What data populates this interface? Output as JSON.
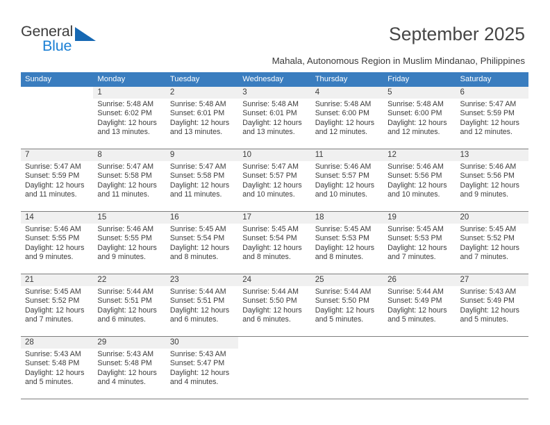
{
  "brand": {
    "word_one": "General",
    "word_two": "Blue",
    "accent_color": "#1a7fd4",
    "triangle_color": "#1668b3"
  },
  "header": {
    "title": "September 2025",
    "subtitle": "Mahala, Autonomous Region in Muslim Mindanao, Philippines"
  },
  "calendar": {
    "header_bg": "#3a7dbf",
    "daynum_band_bg": "#f0f0f0",
    "day_names": [
      "Sunday",
      "Monday",
      "Tuesday",
      "Wednesday",
      "Thursday",
      "Friday",
      "Saturday"
    ],
    "weeks": [
      [
        {
          "day": "",
          "lines": []
        },
        {
          "day": "1",
          "lines": [
            "Sunrise: 5:48 AM",
            "Sunset: 6:02 PM",
            "Daylight: 12 hours",
            "and 13 minutes."
          ]
        },
        {
          "day": "2",
          "lines": [
            "Sunrise: 5:48 AM",
            "Sunset: 6:01 PM",
            "Daylight: 12 hours",
            "and 13 minutes."
          ]
        },
        {
          "day": "3",
          "lines": [
            "Sunrise: 5:48 AM",
            "Sunset: 6:01 PM",
            "Daylight: 12 hours",
            "and 13 minutes."
          ]
        },
        {
          "day": "4",
          "lines": [
            "Sunrise: 5:48 AM",
            "Sunset: 6:00 PM",
            "Daylight: 12 hours",
            "and 12 minutes."
          ]
        },
        {
          "day": "5",
          "lines": [
            "Sunrise: 5:48 AM",
            "Sunset: 6:00 PM",
            "Daylight: 12 hours",
            "and 12 minutes."
          ]
        },
        {
          "day": "6",
          "lines": [
            "Sunrise: 5:47 AM",
            "Sunset: 5:59 PM",
            "Daylight: 12 hours",
            "and 12 minutes."
          ]
        }
      ],
      [
        {
          "day": "7",
          "lines": [
            "Sunrise: 5:47 AM",
            "Sunset: 5:59 PM",
            "Daylight: 12 hours",
            "and 11 minutes."
          ]
        },
        {
          "day": "8",
          "lines": [
            "Sunrise: 5:47 AM",
            "Sunset: 5:58 PM",
            "Daylight: 12 hours",
            "and 11 minutes."
          ]
        },
        {
          "day": "9",
          "lines": [
            "Sunrise: 5:47 AM",
            "Sunset: 5:58 PM",
            "Daylight: 12 hours",
            "and 11 minutes."
          ]
        },
        {
          "day": "10",
          "lines": [
            "Sunrise: 5:47 AM",
            "Sunset: 5:57 PM",
            "Daylight: 12 hours",
            "and 10 minutes."
          ]
        },
        {
          "day": "11",
          "lines": [
            "Sunrise: 5:46 AM",
            "Sunset: 5:57 PM",
            "Daylight: 12 hours",
            "and 10 minutes."
          ]
        },
        {
          "day": "12",
          "lines": [
            "Sunrise: 5:46 AM",
            "Sunset: 5:56 PM",
            "Daylight: 12 hours",
            "and 10 minutes."
          ]
        },
        {
          "day": "13",
          "lines": [
            "Sunrise: 5:46 AM",
            "Sunset: 5:56 PM",
            "Daylight: 12 hours",
            "and 9 minutes."
          ]
        }
      ],
      [
        {
          "day": "14",
          "lines": [
            "Sunrise: 5:46 AM",
            "Sunset: 5:55 PM",
            "Daylight: 12 hours",
            "and 9 minutes."
          ]
        },
        {
          "day": "15",
          "lines": [
            "Sunrise: 5:46 AM",
            "Sunset: 5:55 PM",
            "Daylight: 12 hours",
            "and 9 minutes."
          ]
        },
        {
          "day": "16",
          "lines": [
            "Sunrise: 5:45 AM",
            "Sunset: 5:54 PM",
            "Daylight: 12 hours",
            "and 8 minutes."
          ]
        },
        {
          "day": "17",
          "lines": [
            "Sunrise: 5:45 AM",
            "Sunset: 5:54 PM",
            "Daylight: 12 hours",
            "and 8 minutes."
          ]
        },
        {
          "day": "18",
          "lines": [
            "Sunrise: 5:45 AM",
            "Sunset: 5:53 PM",
            "Daylight: 12 hours",
            "and 8 minutes."
          ]
        },
        {
          "day": "19",
          "lines": [
            "Sunrise: 5:45 AM",
            "Sunset: 5:53 PM",
            "Daylight: 12 hours",
            "and 7 minutes."
          ]
        },
        {
          "day": "20",
          "lines": [
            "Sunrise: 5:45 AM",
            "Sunset: 5:52 PM",
            "Daylight: 12 hours",
            "and 7 minutes."
          ]
        }
      ],
      [
        {
          "day": "21",
          "lines": [
            "Sunrise: 5:45 AM",
            "Sunset: 5:52 PM",
            "Daylight: 12 hours",
            "and 7 minutes."
          ]
        },
        {
          "day": "22",
          "lines": [
            "Sunrise: 5:44 AM",
            "Sunset: 5:51 PM",
            "Daylight: 12 hours",
            "and 6 minutes."
          ]
        },
        {
          "day": "23",
          "lines": [
            "Sunrise: 5:44 AM",
            "Sunset: 5:51 PM",
            "Daylight: 12 hours",
            "and 6 minutes."
          ]
        },
        {
          "day": "24",
          "lines": [
            "Sunrise: 5:44 AM",
            "Sunset: 5:50 PM",
            "Daylight: 12 hours",
            "and 6 minutes."
          ]
        },
        {
          "day": "25",
          "lines": [
            "Sunrise: 5:44 AM",
            "Sunset: 5:50 PM",
            "Daylight: 12 hours",
            "and 5 minutes."
          ]
        },
        {
          "day": "26",
          "lines": [
            "Sunrise: 5:44 AM",
            "Sunset: 5:49 PM",
            "Daylight: 12 hours",
            "and 5 minutes."
          ]
        },
        {
          "day": "27",
          "lines": [
            "Sunrise: 5:43 AM",
            "Sunset: 5:49 PM",
            "Daylight: 12 hours",
            "and 5 minutes."
          ]
        }
      ],
      [
        {
          "day": "28",
          "lines": [
            "Sunrise: 5:43 AM",
            "Sunset: 5:48 PM",
            "Daylight: 12 hours",
            "and 5 minutes."
          ]
        },
        {
          "day": "29",
          "lines": [
            "Sunrise: 5:43 AM",
            "Sunset: 5:48 PM",
            "Daylight: 12 hours",
            "and 4 minutes."
          ]
        },
        {
          "day": "30",
          "lines": [
            "Sunrise: 5:43 AM",
            "Sunset: 5:47 PM",
            "Daylight: 12 hours",
            "and 4 minutes."
          ]
        },
        {
          "day": "",
          "lines": []
        },
        {
          "day": "",
          "lines": []
        },
        {
          "day": "",
          "lines": []
        },
        {
          "day": "",
          "lines": []
        }
      ]
    ]
  }
}
